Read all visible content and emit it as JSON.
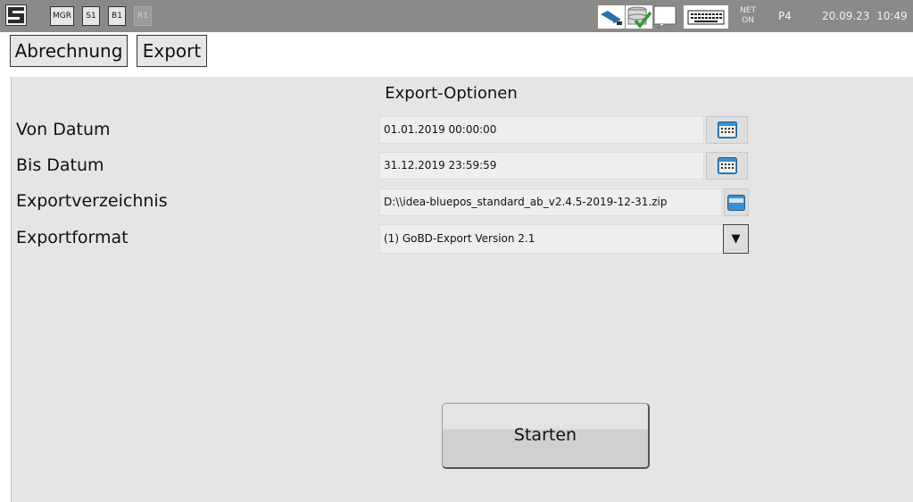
{
  "statusbar": {
    "chips": [
      "MGR",
      "S1",
      "B1",
      "R1"
    ],
    "net_line1": "NET",
    "net_line2": "ON",
    "printer": "P4",
    "datetime": "20.09.23  10:49",
    "icons": [
      "app-logo-icon",
      "network-tools-icon",
      "database-ok-icon",
      "message-icon",
      "keyboard-icon"
    ]
  },
  "tabs": [
    "Abrechnung",
    "Export"
  ],
  "main": {
    "heading": "Export-Optionen",
    "rows": [
      {
        "label": "Von Datum",
        "value": "01.01.2019 00:00:00",
        "button": "calendar-icon"
      },
      {
        "label": "Bis Datum",
        "value": "31.12.2019 23:59:59",
        "button": "calendar-icon"
      },
      {
        "label": "Exportverzeichnis",
        "value": "D:\\\\idea-bluepos_standard_ab_v2.4.5-2019-12-31.zip",
        "button": "folder-icon"
      },
      {
        "label": "Exportformat",
        "value": "(1) GoBD-Export Version 2.1",
        "button": "dropdown-arrow"
      }
    ],
    "dropdown_arrow": "▼",
    "start_label": "Starten"
  },
  "colors": {
    "topbar": "#8a8a8a",
    "panel": "#e5e5e5",
    "accent_blue": "#3a8fd0"
  }
}
